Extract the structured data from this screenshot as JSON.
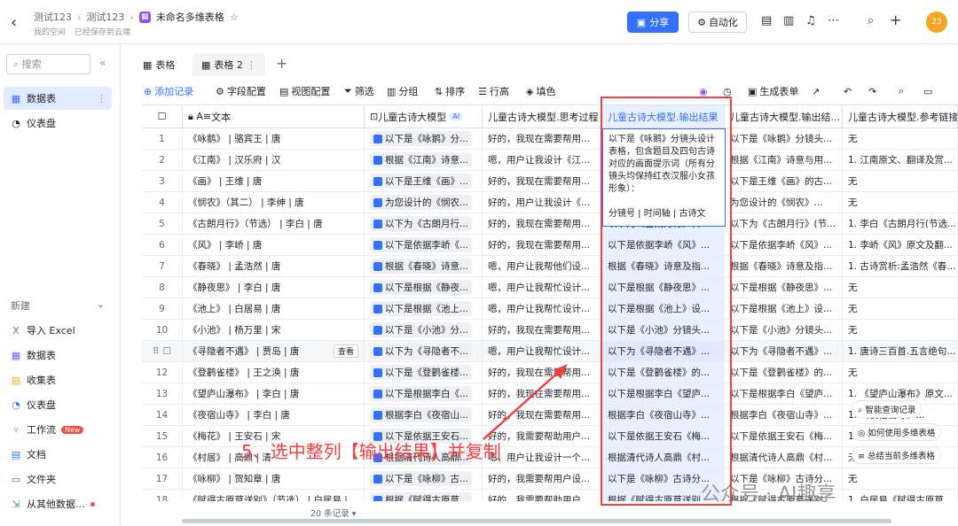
{
  "topbar": {
    "crumbs": [
      "测试123",
      "测试123",
      "未命名多维表格"
    ],
    "sub_space": "我的空间",
    "sub_saved": "已经保存到云端",
    "share_label": "分享",
    "automation_label": "自动化",
    "avatar_text": "23",
    "accent": "#3370ff"
  },
  "sidebar": {
    "search_placeholder": "搜索",
    "items": [
      {
        "label": "数据表",
        "icon": "table-icon"
      },
      {
        "label": "仪表盘",
        "icon": "dashboard-icon"
      }
    ],
    "new_label": "新建",
    "new_items": [
      {
        "label": "导入 Excel",
        "icon": "excel-icon"
      },
      {
        "label": "数据表",
        "icon": "table-icon"
      },
      {
        "label": "收集表",
        "icon": "form-icon"
      },
      {
        "label": "仪表盘",
        "icon": "dashboard-icon"
      },
      {
        "label": "工作流",
        "icon": "workflow-icon",
        "badge": "New"
      },
      {
        "label": "文档",
        "icon": "doc-icon"
      },
      {
        "label": "文件夹",
        "icon": "folder-icon"
      },
      {
        "label": "从其他数据...",
        "icon": "import-icon"
      }
    ]
  },
  "tabs": [
    "表格",
    "表格 2"
  ],
  "toolbar": {
    "add_record": "添加记录",
    "field_config": "字段配置",
    "view_config": "视图配置",
    "filter": "筛选",
    "group": "分组",
    "sort": "排序",
    "row_height": "行高",
    "fill_color": "填色",
    "gen_form": "生成表单"
  },
  "columns": [
    "文本",
    "儿童古诗大模型",
    "儿童古诗大模型.思考过程",
    "儿童古诗大模型.输出结果",
    "儿童古诗大模型.输出结...",
    "儿童古诗大模型.参考链接"
  ],
  "ai_tag": "AI",
  "view_btn": "查看",
  "rows": [
    {
      "n": "1",
      "text": "《咏鹅》 | 骆宾王 | 唐",
      "model": "以下是《咏鹅》分...",
      "think": "好的，我现在需要帮用...",
      "out": "以下是《咏鹅》分镜头...",
      "out2": "以下是《咏鹅》分镜头...",
      "ref": "无"
    },
    {
      "n": "2",
      "text": "《江南》 | 汉乐府 | 汉",
      "model": "根据《江南》诗意...",
      "think": "嗯，用户让我设计《江...",
      "out": "根据《江南》诗意与用...",
      "out2": "根据《江南》诗意与用...",
      "ref": "1. 江南原文、翻译及赏..."
    },
    {
      "n": "3",
      "text": "《画》 | 王维 | 唐",
      "model": "以下是王维《画》...",
      "think": "好的，我现在需要帮用...",
      "out": "以下是王维《画》的古...",
      "out2": "以下是王维《画》的古...",
      "ref": "无"
    },
    {
      "n": "4",
      "text": "《悯农》（其二） | 李绅 | 唐",
      "model": "为您设计的《悯农...",
      "think": "好的，用户让我设计《...",
      "out": "为您设计的《悯农》...",
      "out2": "为您设计的《悯农》...",
      "ref": "无"
    },
    {
      "n": "5",
      "text": "《古朗月行》（节选） | 李白 | 唐",
      "model": "以下为《古朗月行...",
      "think": "好的，我现在需要帮用...",
      "out": "以下为《古朗月行》(节...",
      "out2": "以下为《古朗月行》(节...",
      "ref": "1. 李白《古朗月行(节选..."
    },
    {
      "n": "6",
      "text": "《风》 | 李峤 | 唐",
      "model": "以下是依据李峤《...",
      "think": "好的，我现在需要帮用...",
      "out": "以下是依据李峤《风》...",
      "out2": "以下是依据李峤《风》...",
      "ref": "1. 李峤《风》原文及翻..."
    },
    {
      "n": "7",
      "text": "《春晓》 | 孟浩然 | 唐",
      "model": "根据《春晓》诗意...",
      "think": "嗯，用户让我帮他们设...",
      "out": "根据《春晓》诗意及指...",
      "out2": "根据《春晓》诗意及指...",
      "ref": "1. 古诗赏析:孟浩然《春..."
    },
    {
      "n": "8",
      "text": "《静夜思》 | 李白 | 唐",
      "model": "以下是根据《静夜...",
      "think": "嗯，用户让我帮忙设计...",
      "out": "以下是根据《静夜思》...",
      "out2": "以下是根据《静夜思》...",
      "ref": "无"
    },
    {
      "n": "9",
      "text": "《池上》 | 白居易 | 唐",
      "model": "以下是根据《池上...",
      "think": "嗯，用户让我帮忙设计...",
      "out": "以下是根据《池上》设...",
      "out2": "以下是根据《池上》设...",
      "ref": "无"
    },
    {
      "n": "10",
      "text": "《小池》 | 杨万里 | 宋",
      "model": "以下是《小池》分...",
      "think": "好的，我现在需要帮用...",
      "out": "以下是《小池》分镜头...",
      "out2": "以下是《小池》分镜头...",
      "ref": "无"
    },
    {
      "n": "",
      "text": "《寻隐者不遇》 | 贾岛 | 唐",
      "model": "以下为《寻隐者不...",
      "think": "嗯，用户让我帮忙设计...",
      "out": "以下为《寻隐者不遇》...",
      "out2": "以下为《寻隐者不遇》...",
      "ref": "1. 唐诗三百首.五言绝句..."
    },
    {
      "n": "12",
      "text": "《登鹳雀楼》 | 王之涣 | 唐",
      "model": "以下是《登鹳雀楼...",
      "think": "好的，我现在需要帮用...",
      "out": "以下是《登鹳雀楼》的...",
      "out2": "以下是《登鹳雀楼》的...",
      "ref": "无"
    },
    {
      "n": "13",
      "text": "《望庐山瀑布》 | 李白 | 唐",
      "model": "以下是根据李白《...",
      "think": "好的，我现在需要帮用...",
      "out": "以下是根据李白《望庐...",
      "out2": "以下是根据李白《望庐...",
      "ref": "1. 《望庐山瀑布》原文..."
    },
    {
      "n": "14",
      "text": "《夜宿山寺》 | 李白 | 唐",
      "model": "根据李白《夜宿山...",
      "think": "好的，我现在需要帮用...",
      "out": "根据李白《夜宿山寺》...",
      "out2": "根据李白《夜宿山寺》...",
      "ref": "1. 《夜宿山寺》..."
    },
    {
      "n": "15",
      "text": "《梅花》 | 王安石 | 宋",
      "model": "以下是依据王安石...",
      "think": "好的，我需要帮助用户...",
      "out": "以下是依据王安石《梅...",
      "out2": "以下是依据王安石《梅...",
      "ref": "1. ..."
    },
    {
      "n": "16",
      "text": "《村居》 | 高鼎 | 清",
      "model": "根据清代诗人高鼎...",
      "think": "嗯，用户让我设计一个...",
      "out": "根据清代诗人高鼎《村...",
      "out2": "根据清代诗人高鼎《村...",
      "ref": "无"
    },
    {
      "n": "17",
      "text": "《咏柳》 | 贺知章 | 唐",
      "model": "以下是《咏柳》古...",
      "think": "好的，我需要帮用户设...",
      "out": "以下是《咏柳》古诗分...",
      "out2": "以下是《咏柳》古诗分...",
      "ref": "无"
    },
    {
      "n": "18",
      "text": "《赋得古原草送别》（节选） | 白居易 |",
      "model": "根据《赋得古原草...",
      "think": "好的，我需要帮助用户...",
      "out": "根据《赋得古原草送别...",
      "out2": "根据《赋得古原草送别...",
      "ref": "1. 白居易《赋得古原草..."
    }
  ],
  "popup_text": "以下是《咏鹅》分镜头设计表格，包含题目及四句古诗对应的画面提示词（所有分镜头均保持红衣汉服小女孩形象）：\n\n分镜号 | 时间轴 | 古诗文",
  "annotation": "5、选中整列【输出结果】并复制",
  "footer": "20 条记录",
  "help": [
    "智能查询记录",
    "如何使用多维表格",
    "总结当前多维表格"
  ],
  "watermark": "公众号 · AI趣享"
}
